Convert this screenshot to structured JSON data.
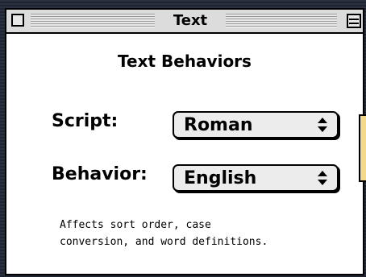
{
  "window": {
    "title": "Text"
  },
  "panel": {
    "heading": "Text Behaviors",
    "script_label": "Script:",
    "script_value": "Roman",
    "behavior_label": "Behavior:",
    "behavior_value": "English",
    "description_line1": "Affects sort order, case",
    "description_line2": "conversion, and word definitions."
  },
  "colors": {
    "desktop": "#222834",
    "window_bg": "#ffffff",
    "titlebar": "#dcdcdc",
    "popup_bg": "#ececec",
    "side_tab": "#f4d98a"
  },
  "icons": [
    "close-box-icon",
    "zoom-box-icon",
    "popup-arrows-icon"
  ]
}
